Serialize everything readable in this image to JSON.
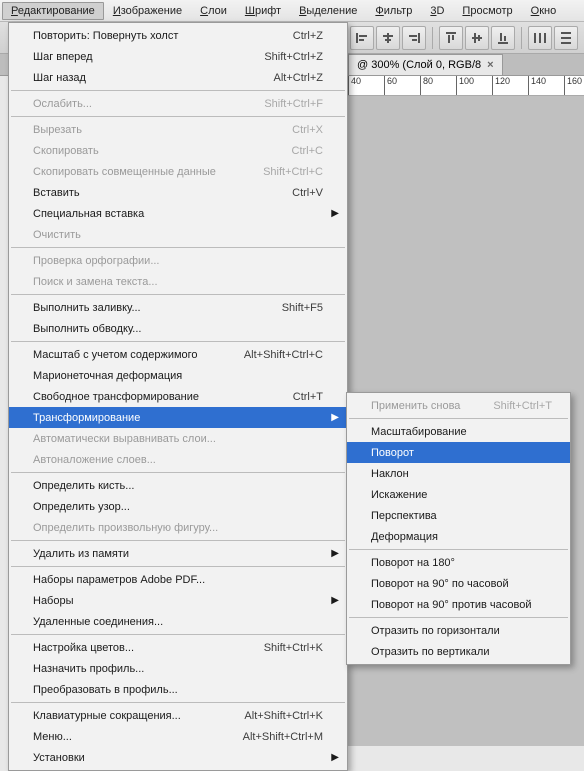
{
  "menubar": {
    "items": [
      {
        "label": "Редактирование",
        "u": 0,
        "active": true
      },
      {
        "label": "Изображение",
        "u": 0
      },
      {
        "label": "Слои",
        "u": 0
      },
      {
        "label": "Шрифт",
        "u": 0
      },
      {
        "label": "Выделение",
        "u": 0
      },
      {
        "label": "Фильтр",
        "u": 0
      },
      {
        "label": "3D",
        "u": 0
      },
      {
        "label": "Просмотр",
        "u": 0
      },
      {
        "label": "Окно",
        "u": 0
      }
    ]
  },
  "doc_tab": {
    "title": "@ 300% (Слой 0, RGB/8",
    "close": "×"
  },
  "ruler_ticks": [
    "40",
    "60",
    "80",
    "100",
    "120",
    "140",
    "160"
  ],
  "edit_menu": [
    {
      "type": "item",
      "label": "Повторить: Повернуть холст",
      "shortcut": "Ctrl+Z"
    },
    {
      "type": "item",
      "label": "Шаг вперед",
      "shortcut": "Shift+Ctrl+Z"
    },
    {
      "type": "item",
      "label": "Шаг назад",
      "shortcut": "Alt+Ctrl+Z"
    },
    {
      "type": "sep"
    },
    {
      "type": "item",
      "label": "Ослабить...",
      "shortcut": "Shift+Ctrl+F",
      "disabled": true
    },
    {
      "type": "sep"
    },
    {
      "type": "item",
      "label": "Вырезать",
      "shortcut": "Ctrl+X",
      "disabled": true
    },
    {
      "type": "item",
      "label": "Скопировать",
      "shortcut": "Ctrl+C",
      "disabled": true
    },
    {
      "type": "item",
      "label": "Скопировать совмещенные данные",
      "shortcut": "Shift+Ctrl+C",
      "disabled": true
    },
    {
      "type": "item",
      "label": "Вставить",
      "shortcut": "Ctrl+V"
    },
    {
      "type": "item",
      "label": "Специальная вставка",
      "submenu": true
    },
    {
      "type": "item",
      "label": "Очистить",
      "disabled": true
    },
    {
      "type": "sep"
    },
    {
      "type": "item",
      "label": "Проверка орфографии...",
      "disabled": true
    },
    {
      "type": "item",
      "label": "Поиск и замена текста...",
      "disabled": true
    },
    {
      "type": "sep"
    },
    {
      "type": "item",
      "label": "Выполнить заливку...",
      "shortcut": "Shift+F5"
    },
    {
      "type": "item",
      "label": "Выполнить обводку..."
    },
    {
      "type": "sep"
    },
    {
      "type": "item",
      "label": "Масштаб с учетом содержимого",
      "shortcut": "Alt+Shift+Ctrl+C"
    },
    {
      "type": "item",
      "label": "Марионеточная деформация"
    },
    {
      "type": "item",
      "label": "Свободное трансформирование",
      "shortcut": "Ctrl+T"
    },
    {
      "type": "item",
      "label": "Трансформирование",
      "submenu": true,
      "selected": true
    },
    {
      "type": "item",
      "label": "Автоматически выравнивать слои...",
      "disabled": true
    },
    {
      "type": "item",
      "label": "Автоналожение слоев...",
      "disabled": true
    },
    {
      "type": "sep"
    },
    {
      "type": "item",
      "label": "Определить кисть..."
    },
    {
      "type": "item",
      "label": "Определить узор..."
    },
    {
      "type": "item",
      "label": "Определить произвольную фигуру...",
      "disabled": true
    },
    {
      "type": "sep"
    },
    {
      "type": "item",
      "label": "Удалить из памяти",
      "submenu": true
    },
    {
      "type": "sep"
    },
    {
      "type": "item",
      "label": "Наборы параметров Adobe PDF..."
    },
    {
      "type": "item",
      "label": "Наборы",
      "submenu": true
    },
    {
      "type": "item",
      "label": "Удаленные соединения..."
    },
    {
      "type": "sep"
    },
    {
      "type": "item",
      "label": "Настройка цветов...",
      "shortcut": "Shift+Ctrl+K"
    },
    {
      "type": "item",
      "label": "Назначить профиль..."
    },
    {
      "type": "item",
      "label": "Преобразовать в профиль..."
    },
    {
      "type": "sep"
    },
    {
      "type": "item",
      "label": "Клавиатурные сокращения...",
      "shortcut": "Alt+Shift+Ctrl+K"
    },
    {
      "type": "item",
      "label": "Меню...",
      "shortcut": "Alt+Shift+Ctrl+M"
    },
    {
      "type": "item",
      "label": "Установки",
      "submenu": true
    }
  ],
  "transform_submenu": [
    {
      "type": "item",
      "label": "Применить снова",
      "shortcut": "Shift+Ctrl+T",
      "disabled": true
    },
    {
      "type": "sep"
    },
    {
      "type": "item",
      "label": "Масштабирование"
    },
    {
      "type": "item",
      "label": "Поворот",
      "selected": true
    },
    {
      "type": "item",
      "label": "Наклон"
    },
    {
      "type": "item",
      "label": "Искажение"
    },
    {
      "type": "item",
      "label": "Перспектива"
    },
    {
      "type": "item",
      "label": "Деформация"
    },
    {
      "type": "sep"
    },
    {
      "type": "item",
      "label": "Поворот на 180°"
    },
    {
      "type": "item",
      "label": "Поворот на 90° по часовой"
    },
    {
      "type": "item",
      "label": "Поворот на 90° против часовой"
    },
    {
      "type": "sep"
    },
    {
      "type": "item",
      "label": "Отразить по горизонтали"
    },
    {
      "type": "item",
      "label": "Отразить по вертикали"
    }
  ]
}
